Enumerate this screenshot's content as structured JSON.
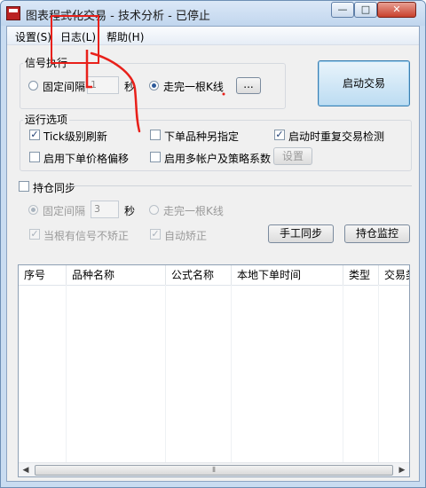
{
  "window": {
    "title": "图表程式化交易 - 技术分析 - 已停止",
    "controls": {
      "minimize": "—",
      "maximize": "□",
      "close": "✕"
    }
  },
  "menu": [
    {
      "label": "设置(S)"
    },
    {
      "label": "日志(L)"
    },
    {
      "label": "帮助(H)"
    }
  ],
  "signal_exec": {
    "legend": "信号执行",
    "fixed_interval_label": "固定间隔",
    "interval_value": "1",
    "seconds_label": "秒",
    "one_bar_label": "走完一根K线",
    "more_button": "...",
    "selected": "one_bar"
  },
  "start_button": "启动交易",
  "run_options": {
    "legend": "运行选项",
    "tick_refresh": {
      "label": "Tick级别刷新",
      "checked": true
    },
    "order_override": {
      "label": "下单品种另指定",
      "checked": false
    },
    "recheck_on_start": {
      "label": "启动时重复交易检测",
      "checked": true
    },
    "price_offset": {
      "label": "启用下单价格偏移",
      "checked": false
    },
    "multi_account": {
      "label": "启用多帐户及策略系数",
      "checked": false
    },
    "settings_button": "设置"
  },
  "position_sync": {
    "label": "持仓同步",
    "checked": false,
    "fixed_interval_label": "固定间隔",
    "interval_value": "3",
    "seconds_label": "秒",
    "one_bar_label": "走完一根K线",
    "no_correct_label": "当根有信号不矫正",
    "no_correct_checked": true,
    "auto_correct_label": "自动矫正",
    "auto_correct_checked": true,
    "manual_sync_button": "手工同步",
    "monitor_button": "持仓监控"
  },
  "table": {
    "columns": [
      "序号",
      "品种名称",
      "公式名称",
      "本地下单时间",
      "类型",
      "交易类型"
    ],
    "rows": []
  },
  "colors": {
    "annotation": "#e8201a",
    "accent": "#2d5a9a"
  }
}
